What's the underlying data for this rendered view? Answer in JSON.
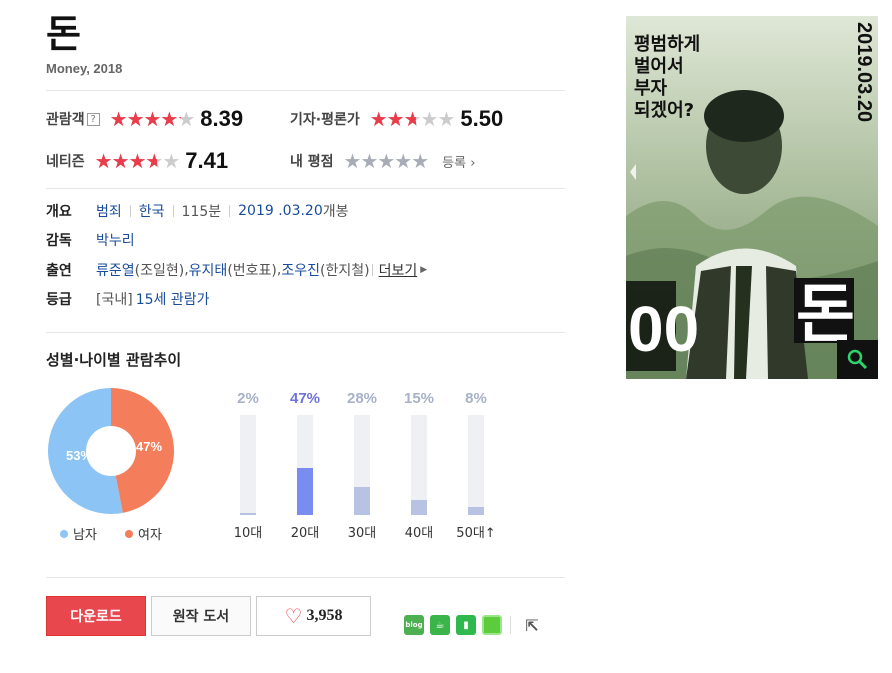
{
  "movie": {
    "title": "돈",
    "subtitle": "Money, 2018"
  },
  "ratings": {
    "audience": {
      "label": "관람객",
      "score": "8.39",
      "fill": 0.839
    },
    "critics": {
      "label": "기자·평론가",
      "score": "5.50",
      "fill": 0.55
    },
    "netizen": {
      "label": "네티즌",
      "score": "7.41",
      "fill": 0.741
    },
    "mine": {
      "label": "내 평점",
      "register": "등록"
    },
    "help_mark": "?"
  },
  "info": {
    "overview_label": "개요",
    "genre": "범죄",
    "country": "한국",
    "runtime": "115분",
    "release_date": "2019 .03.20",
    "release_suffix": "개봉",
    "director_label": "감독",
    "director": "박누리",
    "cast_label": "출연",
    "cast": [
      {
        "actor": "류준열",
        "role": "(조일현)"
      },
      {
        "actor": "유지태",
        "role": "(번호표)"
      },
      {
        "actor": "조우진",
        "role": "(한지철)"
      }
    ],
    "more": "더보기",
    "grade_label": "등급",
    "grade_prefix": "[국내]",
    "grade": "15세 관람가"
  },
  "trend": {
    "title": "성별·나이별 관람추이",
    "gender": {
      "male_pct": 53,
      "female_pct": 47,
      "male_label": "남자",
      "female_label": "여자",
      "male_text": "53%",
      "female_text": "47%",
      "male_color": "#8cc4f5",
      "female_color": "#f47d5b"
    },
    "ages": [
      {
        "label": "10대",
        "pct": 2,
        "text": "2%"
      },
      {
        "label": "20대",
        "pct": 47,
        "text": "47%"
      },
      {
        "label": "30대",
        "pct": 28,
        "text": "28%"
      },
      {
        "label": "40대",
        "pct": 15,
        "text": "15%"
      },
      {
        "label": "50대",
        "pct": 8,
        "text": "8%"
      }
    ],
    "age_up_mark": "↑"
  },
  "actions": {
    "download": "다운로드",
    "book": "원작 도서",
    "likes": "3,958"
  },
  "share_icons": [
    "blog-icon",
    "cafe-icon",
    "bookmark-icon",
    "memo-icon",
    "share-icon"
  ],
  "share_labels": {
    "blog": "blog"
  },
  "poster": {
    "tagline": "평범하게 벌어서 부자 되겠어?",
    "date": "2019.03.20",
    "title": "돈",
    "number_fragment": "00"
  }
}
